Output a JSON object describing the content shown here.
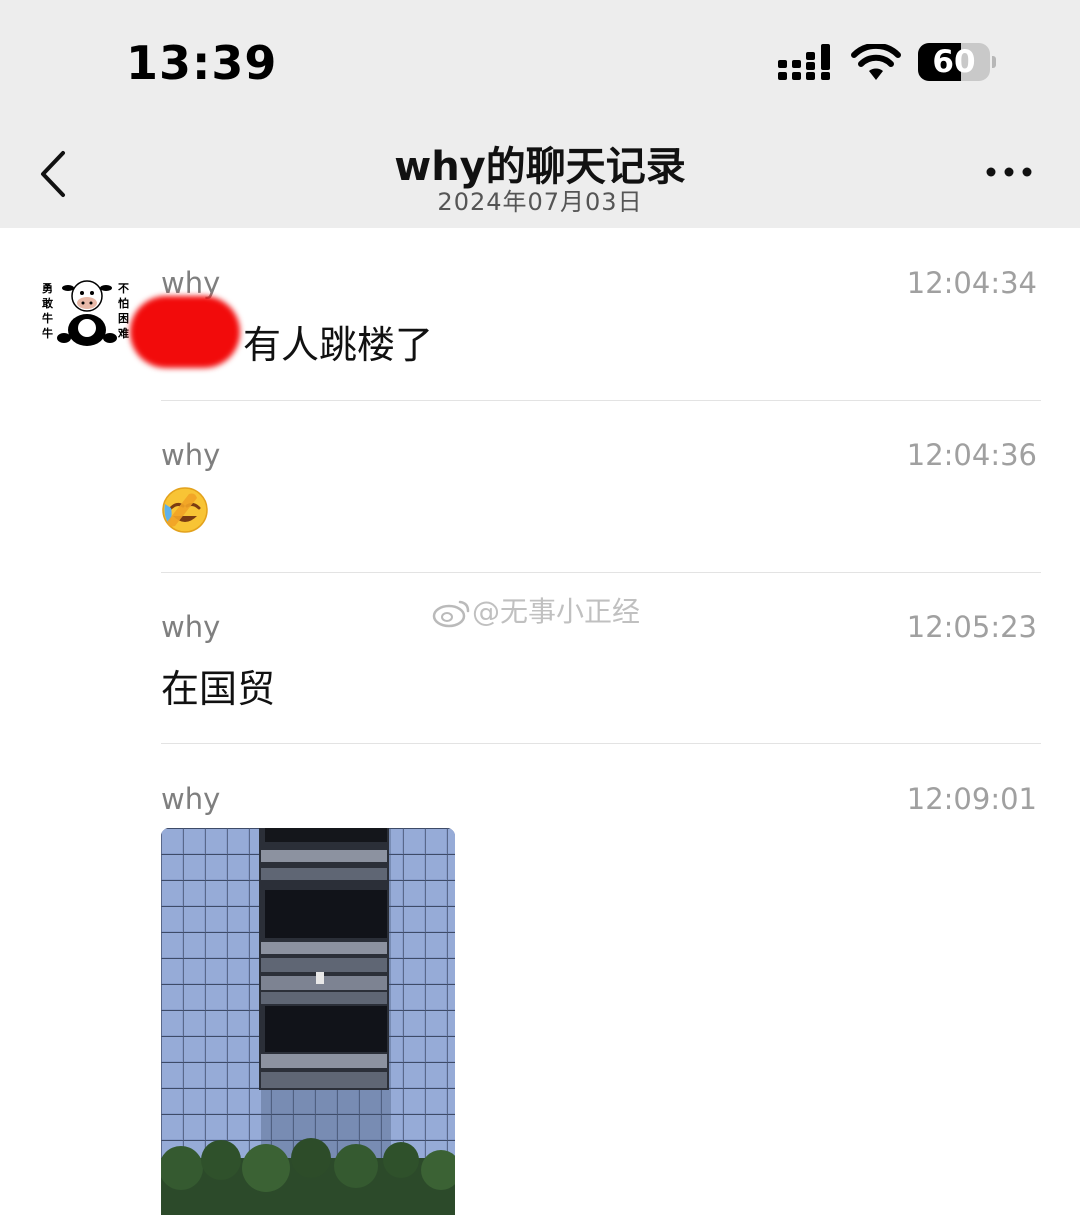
{
  "status_bar": {
    "time": "13:39",
    "battery": "60",
    "battery_level": 0.6
  },
  "header": {
    "title": "why的聊天记录",
    "subtitle": "2024年07月03日"
  },
  "avatar": {
    "left_text": "勇敢牛牛",
    "right_text": "不怕困难"
  },
  "messages": [
    {
      "sender": "why",
      "time": "12:04:34",
      "text": "有人跳楼了"
    },
    {
      "sender": "why",
      "time": "12:04:36",
      "emoji": "face-with-tears-of-joy-icon"
    },
    {
      "sender": "why",
      "time": "12:05:23",
      "text": "在国贸"
    },
    {
      "sender": "why",
      "time": "12:09:01",
      "image": "building-photo"
    }
  ],
  "watermark": "@无事小正经",
  "colors": {
    "bar_bg": "#ededed",
    "redaction": "#f20b0b",
    "timestamp": "#a0a0a0"
  }
}
